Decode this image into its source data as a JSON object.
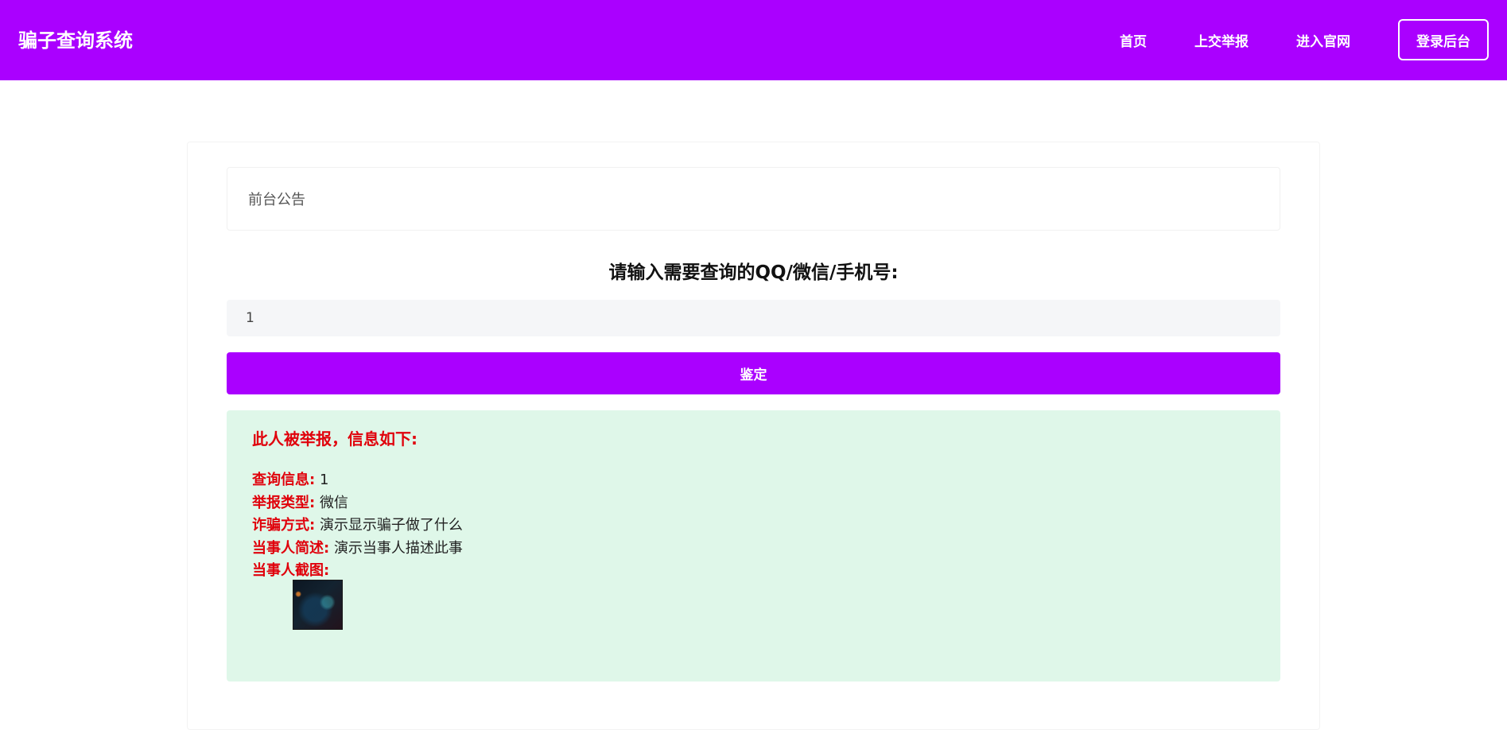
{
  "header": {
    "brand": "骗子查询系统",
    "nav": [
      {
        "label": "首页"
      },
      {
        "label": "上交举报"
      },
      {
        "label": "进入官网"
      }
    ],
    "login_label": "登录后台",
    "background_color": "#aa00ff"
  },
  "notice": {
    "text": "前台公告"
  },
  "query": {
    "title": "请输入需要查询的QQ/微信/手机号:",
    "input_value": "1",
    "button_label": "鉴定"
  },
  "result": {
    "heading": "此人被举报，信息如下:",
    "background_color": "#dff7e9",
    "label_color": "#e0000b",
    "fields": [
      {
        "label": "查询信息:",
        "value": "1"
      },
      {
        "label": "举报类型:",
        "value": "微信"
      },
      {
        "label": "诈骗方式:",
        "value": "演示显示骗子做了什么"
      },
      {
        "label": "当事人简述:",
        "value": "演示当事人描述此事"
      },
      {
        "label": "当事人截图:",
        "value": ""
      }
    ],
    "screenshot_icon": "image-thumbnail"
  }
}
